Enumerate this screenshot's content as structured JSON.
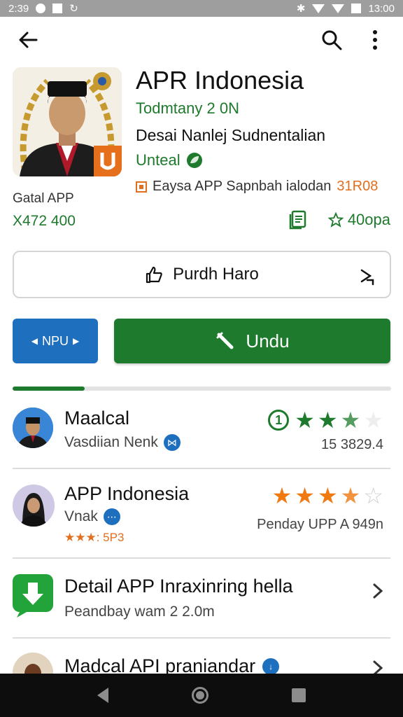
{
  "status_bar": {
    "time_left": "2:39",
    "time_right": "13:00"
  },
  "app_bar": {
    "back_icon": "arrow-left-icon",
    "search_icon": "search-icon",
    "menu_icon": "more-vert-icon"
  },
  "header": {
    "title": "APR Indonesia",
    "developer": "Todmtany 2 0N",
    "subtitle": "Desai Nanlej Sudnentalian",
    "update_label": "Unteal",
    "info_text": "Eaysa APP Sapnbah ialodan",
    "info_price": "31R08",
    "meta_label": "Gatal APP",
    "meta_count": "X472 400",
    "rating_text": "40opa"
  },
  "buttons": {
    "outline_label": "Purdh Haro",
    "npu_label": "NPU",
    "install_label": "Undu"
  },
  "progress": {
    "value": 0.19
  },
  "list": [
    {
      "title": "Maalcal",
      "subtitle": "Vasdiian Nenk",
      "stat": "15 3829.4",
      "rank": "1",
      "rating_stars": 2.5
    },
    {
      "title": "APP Indonesia",
      "subtitle": "Vnak",
      "rating_small": "★★★: 5P3",
      "stat": "Penday UPP A  949n",
      "rating_stars": 3.5
    },
    {
      "title": "Detail APP Inraxinring hella",
      "subtitle": "Peandbay wam 2 2.0m"
    },
    {
      "title": "Madcal API praniandar"
    }
  ],
  "colors": {
    "green": "#1e7a2c",
    "blue": "#1f6fbf",
    "orange": "#e26f1e"
  }
}
